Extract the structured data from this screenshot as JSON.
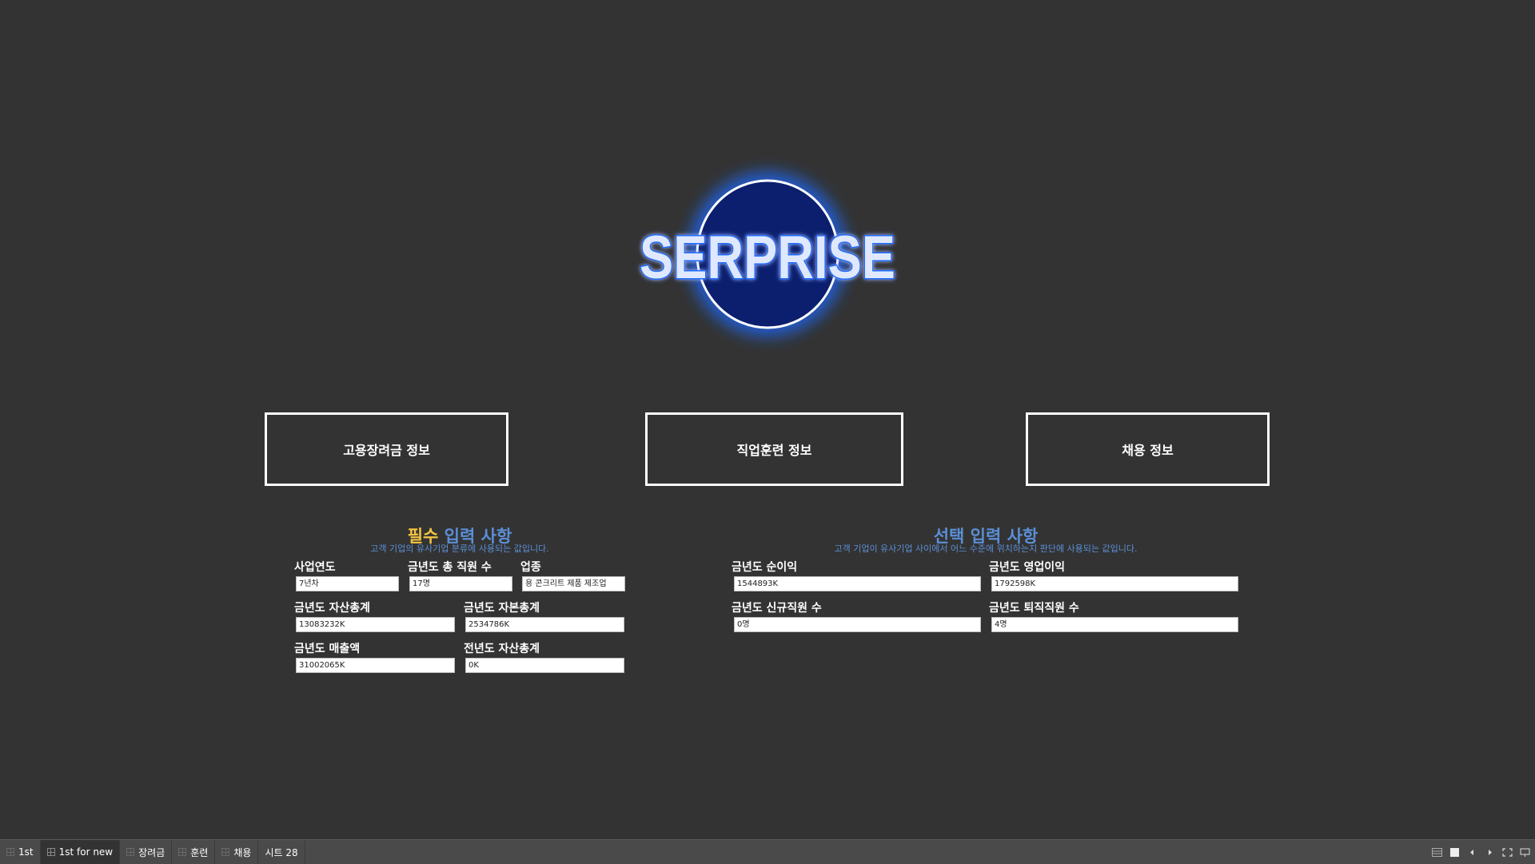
{
  "logo": {
    "text": "SERPRISE"
  },
  "nav": {
    "subsidy": "고용장려금 정보",
    "training": "직업훈련 정보",
    "hiring": "채용 정보"
  },
  "required": {
    "title_highlight": "필수",
    "title_rest": " 입력 사항",
    "subtitle": "고객 기업의 유사기업 분류에 사용되는 값입니다.",
    "fields": {
      "business_year": {
        "label": "사업연도",
        "value": "7년차"
      },
      "employees": {
        "label": "금년도 총 직원 수",
        "value": "17명"
      },
      "industry": {
        "label": "업종",
        "value": "용 콘크리트 제품 제조업"
      },
      "total_assets": {
        "label": "금년도 자산총계",
        "value": "13083232K"
      },
      "total_capital": {
        "label": "금년도 자본총계",
        "value": "2534786K"
      },
      "revenue": {
        "label": "금년도 매출액",
        "value": "31002065K"
      },
      "prev_assets": {
        "label": "전년도 자산총계",
        "value": "0K"
      }
    }
  },
  "optional": {
    "title": "선택 입력 사항",
    "subtitle": "고객 기업이 유사기업 사이에서 어느 수준에 위치하는지 판단에 사용되는 값입니다.",
    "fields": {
      "net_income": {
        "label": "금년도 순이익",
        "value": "1544893K"
      },
      "operating_income": {
        "label": "금년도 영업이익",
        "value": "1792598K"
      },
      "new_employees": {
        "label": "금년도 신규직원 수",
        "value": "0명"
      },
      "retired_employees": {
        "label": "금년도 퇴직직원 수",
        "value": "4명"
      }
    }
  },
  "tabs": [
    "1st",
    "1st for new",
    "장려금",
    "훈련",
    "채용",
    "시트 28"
  ],
  "colors": {
    "background": "#333333",
    "accent_yellow": "#f4c542",
    "accent_blue": "#5b8fd6",
    "logo_glow": "#1e6bff"
  }
}
